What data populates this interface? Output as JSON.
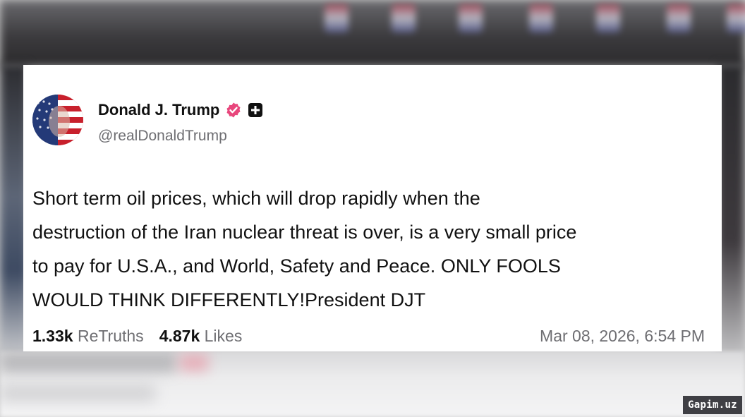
{
  "post": {
    "author_name": "Donald J. Trump",
    "handle": "@realDonaldTrump",
    "text": "Short term oil prices, which will drop rapidly when the\ndestruction of the Iran nuclear threat is over, is a very small price\nto pay for U.S.A., and World, Safety and Peace. ONLY FOOLS\nWOULD THINK DIFFERENTLY!President DJT",
    "retruths_count": "1.33k",
    "retruths_label": "ReTruths",
    "likes_count": "4.87k",
    "likes_label": "Likes",
    "timestamp": "Mar 08, 2026, 6:54 PM"
  },
  "badges": {
    "verified_icon": "verified-badge-icon",
    "verified_color": "#e8467c",
    "plus_icon": "plus-square-icon"
  },
  "watermark": {
    "text": "Gapim.uz"
  }
}
